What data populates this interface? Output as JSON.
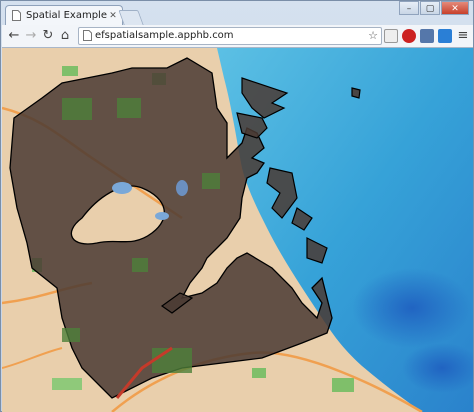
{
  "browser": {
    "tab_title": "Spatial Example",
    "tab_close": "✕",
    "url": "efspatialsample.apphb.com",
    "back_glyph": "←",
    "forward_glyph": "→",
    "reload_glyph": "↻",
    "home_glyph": "⌂",
    "star_glyph": "☆",
    "window_minimize": "–",
    "window_maximize": "▢",
    "window_close": "✕",
    "menu_glyph": "≡"
  },
  "map": {
    "description_colors": {
      "water": "#3aa3d6",
      "land": "#e8c9a4",
      "polygon_fill": "#4a3a32",
      "polygon_stroke": "#000000"
    }
  }
}
